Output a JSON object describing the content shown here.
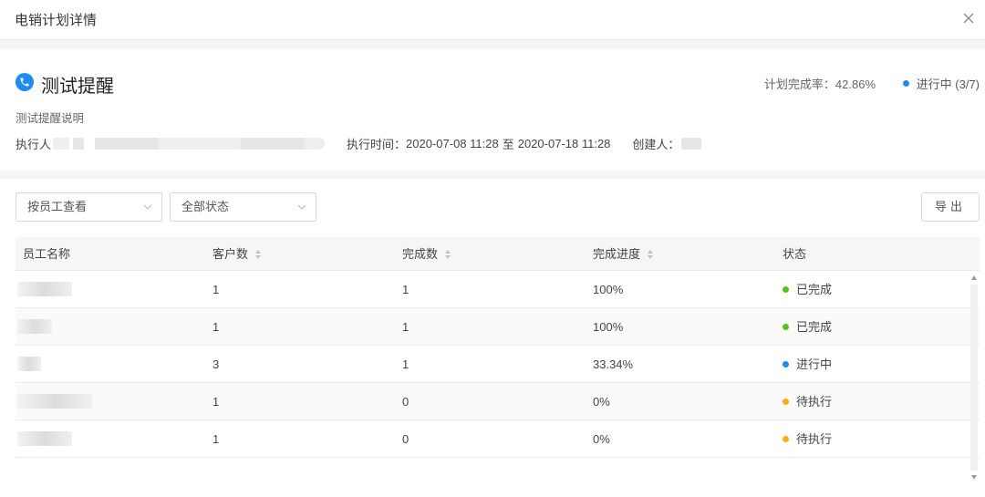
{
  "modal": {
    "title": "电销计划详情"
  },
  "plan": {
    "title": "测试提醒",
    "description": "测试提醒说明",
    "completion_label": "计划完成率：",
    "completion_value": "42.86%",
    "status_label": "进行中 (3/7)",
    "executor_label": "执行人",
    "time_label": "执行时间：",
    "time_start": "2020-07-08 11:28",
    "time_sep": "至",
    "time_end": "2020-07-18 11:28",
    "creator_label": "创建人："
  },
  "filters": {
    "view_by": "按员工查看",
    "status": "全部状态",
    "export": "导出"
  },
  "table": {
    "headers": [
      "员工名称",
      "客户数",
      "完成数",
      "完成进度",
      "状态"
    ],
    "rows": [
      {
        "customers": "1",
        "done": "1",
        "progress": "100%",
        "status": "已完成"
      },
      {
        "customers": "1",
        "done": "1",
        "progress": "100%",
        "status": "已完成"
      },
      {
        "customers": "3",
        "done": "1",
        "progress": "33.34%",
        "status": "进行中"
      },
      {
        "customers": "1",
        "done": "0",
        "progress": "0%",
        "status": "待执行"
      },
      {
        "customers": "1",
        "done": "0",
        "progress": "0%",
        "status": "待执行"
      }
    ]
  },
  "colors": {
    "accent": "#1f8bf0",
    "completed": "#52c41a",
    "in_progress": "#1f8bf0",
    "pending": "#faad14"
  }
}
